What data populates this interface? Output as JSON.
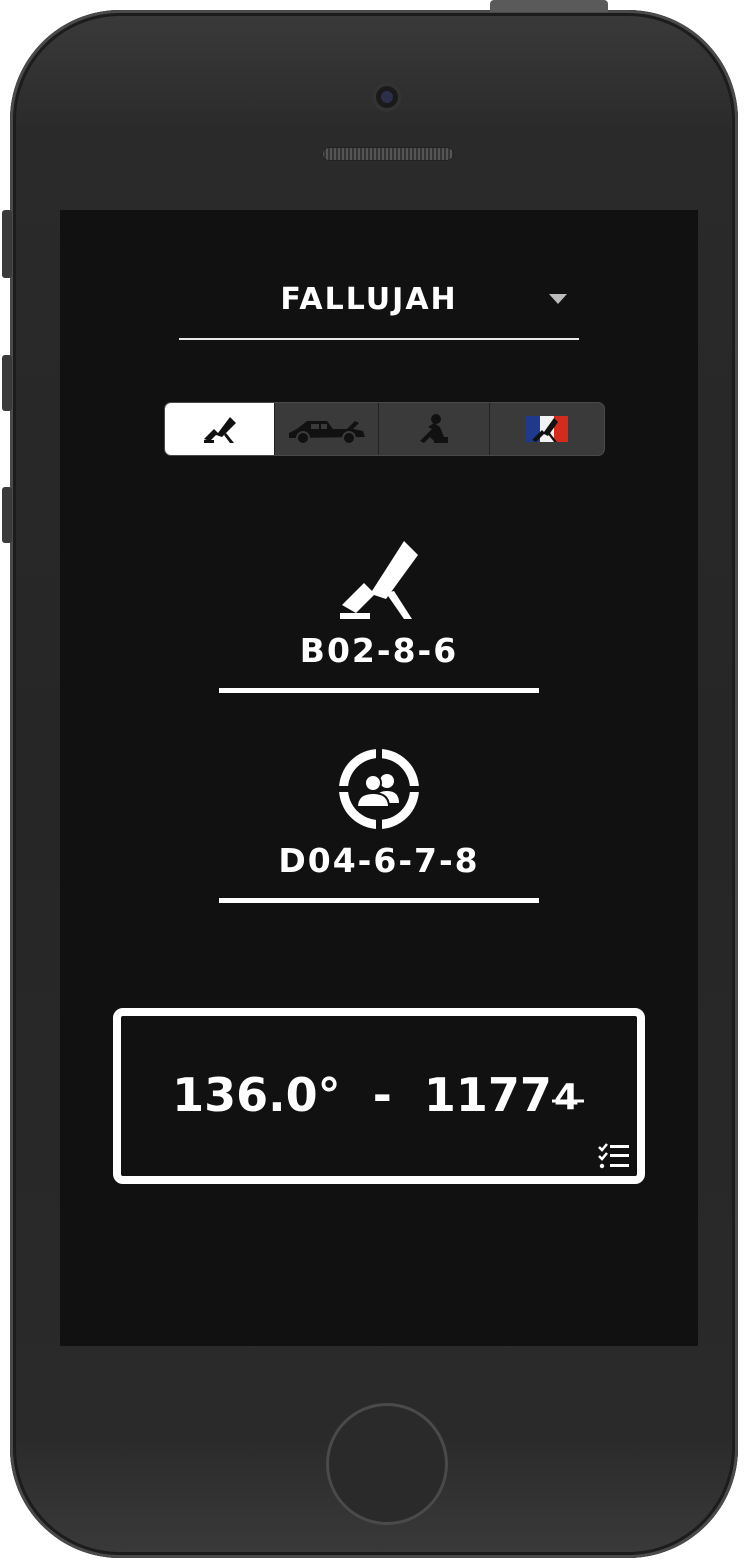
{
  "map_selector": {
    "value": "FALLUJAH"
  },
  "mode_tabs": [
    {
      "name": "mortar",
      "active": true
    },
    {
      "name": "technical-vehicle",
      "active": false
    },
    {
      "name": "kneeling-soldier",
      "active": false
    },
    {
      "name": "flag-mortar",
      "active": false
    }
  ],
  "mortar_position": {
    "value": "B02-8-6"
  },
  "target_position": {
    "value": "D04-6-7-8"
  },
  "result": {
    "azimuth": "136.0°",
    "separator": "-",
    "elevation": "1177"
  },
  "colors": {
    "background": "#111111",
    "foreground": "#ffffff",
    "segment_bg": "#3a3a3a",
    "flag_blue": "#1f3a8a",
    "flag_red": "#d52b1e"
  }
}
